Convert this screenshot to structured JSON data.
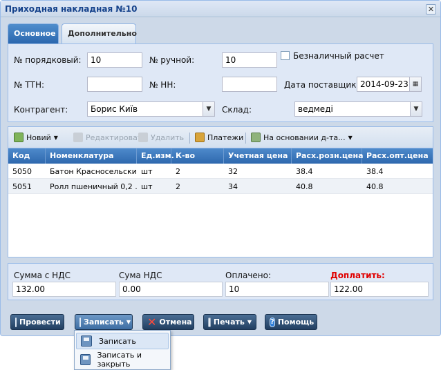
{
  "window": {
    "title": "Приходная накладная №10",
    "close_glyph": "✕"
  },
  "tabs": [
    {
      "label": "Основное",
      "active": true
    },
    {
      "label": "Дополнительно",
      "active": false
    }
  ],
  "form": {
    "order_no_label": "№ порядковый:",
    "order_no_value": "10",
    "manual_no_label": "№ ручной:",
    "manual_no_value": "10",
    "cashless_label": "Безналичный расчет",
    "cashless_checked": false,
    "ttn_label": "№ ТТН:",
    "ttn_value": "",
    "nn_label": "№ НН:",
    "nn_value": "",
    "supplier_date_label": "Дата поставщика:",
    "supplier_date_value": "2014-09-23",
    "contractor_label": "Контрагент:",
    "contractor_value": "Борис Київ",
    "warehouse_label": "Склад:",
    "warehouse_value": "ведмеді"
  },
  "toolbar": {
    "new_label": "Новий",
    "edit_label": "Редактировать",
    "delete_label": "Удалить",
    "payments_label": "Платежи",
    "based_on_label": "На основании д-та..."
  },
  "table": {
    "columns": [
      "Код",
      "Номенклатура",
      "Ед.изм.",
      "К-во",
      "Учетная цена",
      "Расх.розн.цена",
      "Расх.опт.цена"
    ],
    "rows": [
      [
        "5050",
        "Батон Красносельски...",
        "шт",
        "2",
        "32",
        "38.4",
        "38.4"
      ],
      [
        "5051",
        "Ролл пшеничный 0,2 ...",
        "шт",
        "2",
        "34",
        "40.8",
        "40.8"
      ]
    ]
  },
  "summary": {
    "sum_vat_label": "Сумма с НДС",
    "sum_vat_value": "132.00",
    "vat_label": "Сума НДС",
    "vat_value": "0.00",
    "paid_label": "Оплачено:",
    "paid_value": "10",
    "due_label": "Доплатить:",
    "due_value": "122.00",
    "due_color": "#e00000"
  },
  "buttons": {
    "post_label": "Провести",
    "save_label": "Записать",
    "cancel_label": "Отмена",
    "print_label": "Печать",
    "help_label": "Помощь"
  },
  "save_menu": {
    "items": [
      {
        "label": "Записать",
        "hover": true
      },
      {
        "label": "Записать и закрыть",
        "hover": false
      }
    ]
  }
}
